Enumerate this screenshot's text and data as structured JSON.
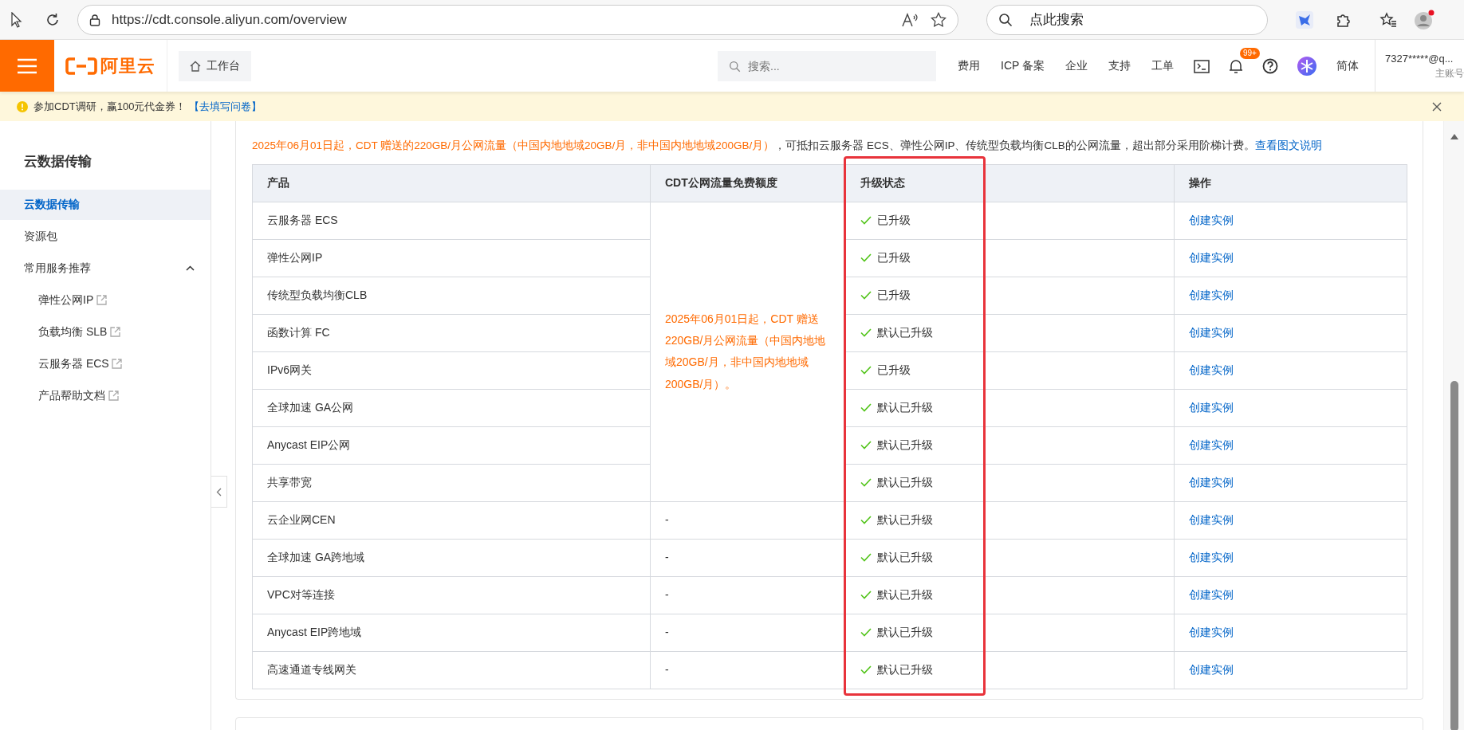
{
  "browser": {
    "url": "https://cdt.console.aliyun.com/overview",
    "search_placeholder": "点此搜索"
  },
  "header": {
    "logo_text": "阿里云",
    "workbench": "工作台",
    "search_placeholder": "搜索...",
    "nav": [
      {
        "kind": "text",
        "label": "费用"
      },
      {
        "kind": "text",
        "label": "ICP 备案"
      },
      {
        "kind": "text",
        "label": "企业"
      },
      {
        "kind": "text",
        "label": "支持"
      },
      {
        "kind": "text",
        "label": "工单"
      },
      {
        "kind": "terminal"
      },
      {
        "kind": "bell",
        "badge": "99+"
      },
      {
        "kind": "help"
      },
      {
        "kind": "app"
      },
      {
        "kind": "text",
        "label": "简体"
      }
    ],
    "account": {
      "name": "7327*****@q...",
      "role": "主账号"
    }
  },
  "notice": {
    "text": "参加CDT调研，赢100元代金券！",
    "link": "【去填写问卷】"
  },
  "sidebar": {
    "title": "云数据传输",
    "items": [
      {
        "label": "云数据传输",
        "selected": true
      },
      {
        "label": "资源包",
        "selected": false
      },
      {
        "label": "常用服务推荐",
        "selected": false,
        "expanded": true,
        "children": [
          {
            "label": "弹性公网IP",
            "external": true
          },
          {
            "label": "负载均衡 SLB",
            "external": true
          },
          {
            "label": "云服务器 ECS",
            "external": true
          },
          {
            "label": "产品帮助文档",
            "external": true
          }
        ]
      }
    ]
  },
  "intro": {
    "highlight": "2025年06月01日起，CDT 赠送的220GB/月公网流量（中国内地地域20GB/月，非中国内地地域200GB/月）",
    "text": "，可抵扣云服务器 ECS、弹性公网IP、传统型负载均衡CLB的公网流量，超出部分采用阶梯计费。",
    "link": "查看图文说明"
  },
  "table": {
    "columns": [
      {
        "label": "产品",
        "highlighted": false
      },
      {
        "label": "CDT公网流量免费额度",
        "highlighted": false
      },
      {
        "label": "升级状态",
        "highlighted": true
      },
      {
        "label": "操作",
        "highlighted": false
      }
    ],
    "shared_quota": "2025年06月01日起，CDT 赠送220GB/月公网流量（中国内地地域20GB/月，非中国内地地域200GB/月）。",
    "rows": [
      {
        "product": "云服务器 ECS",
        "status": "已升级",
        "action": "创建实例"
      },
      {
        "product": "弹性公网IP",
        "status": "已升级",
        "action": "创建实例"
      },
      {
        "product": "传统型负载均衡CLB",
        "status": "已升级",
        "action": "创建实例"
      },
      {
        "product": "函数计算 FC",
        "status": "默认已升级",
        "action": "创建实例"
      },
      {
        "product": "IPv6网关",
        "status": "已升级",
        "action": "创建实例"
      },
      {
        "product": "全球加速 GA公网",
        "status": "默认已升级",
        "action": "创建实例"
      },
      {
        "product": "Anycast EIP公网",
        "status": "默认已升级",
        "action": "创建实例"
      },
      {
        "product": "共享带宽",
        "status": "默认已升级",
        "action": "创建实例"
      },
      {
        "product": "云企业网CEN",
        "quota": "-",
        "status": "默认已升级",
        "action": "创建实例"
      },
      {
        "product": "全球加速 GA跨地域",
        "quota": "-",
        "status": "默认已升级",
        "action": "创建实例"
      },
      {
        "product": "VPC对等连接",
        "quota": "-",
        "status": "默认已升级",
        "action": "创建实例"
      },
      {
        "product": "Anycast EIP跨地域",
        "quota": "-",
        "status": "默认已升级",
        "action": "创建实例"
      },
      {
        "product": "高速通道专线网关",
        "quota": "-",
        "status": "默认已升级",
        "action": "创建实例"
      }
    ]
  }
}
